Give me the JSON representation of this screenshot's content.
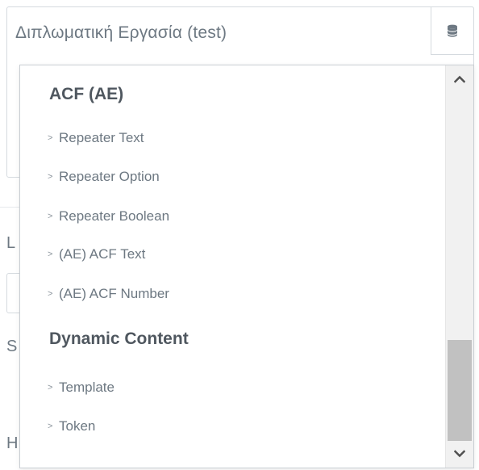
{
  "field": {
    "value": "Διπλωματική Εργασία (test)",
    "dynamic_tags_icon": "database-icon"
  },
  "background_letters": [
    "L",
    "S",
    "H"
  ],
  "dropdown": {
    "groups": [
      {
        "title": "ACF (AE)",
        "items": [
          "Repeater Text",
          "Repeater Option",
          "Repeater Boolean",
          "(AE) ACF Text",
          "(AE) ACF Number"
        ]
      },
      {
        "title": "Dynamic Content",
        "items": [
          "Template",
          "Token"
        ]
      }
    ],
    "item_marker": ">",
    "scrollbar": {
      "up_icon": "chevron-up-icon",
      "down_icon": "chevron-down-icon"
    }
  }
}
